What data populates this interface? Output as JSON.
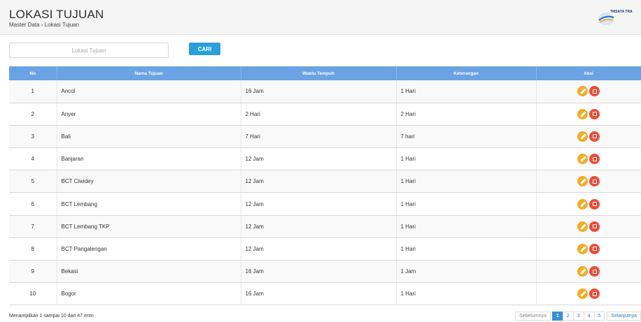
{
  "header": {
    "title": "LOKASI TUJUAN",
    "breadcrumb": "Master Data › Lokasi Tujuan",
    "logo_text": "TMSAYA TRA"
  },
  "search": {
    "placeholder": "Lokasi Tujuan",
    "button_label": "CARI",
    "button_color": "#2a9fd8"
  },
  "table": {
    "header_color": "#6aa2e3",
    "columns": [
      "No",
      "Nama Tujuan",
      "Waktu Tempuh",
      "Keterangan",
      "Aksi"
    ],
    "rows": [
      {
        "no": "1",
        "nama": "Ancol",
        "waktu": "16 Jam",
        "keterangan": "1 Hari"
      },
      {
        "no": "2",
        "nama": "Anyer",
        "waktu": "2 Hari",
        "keterangan": "2 Hari"
      },
      {
        "no": "3",
        "nama": "Bali",
        "waktu": "7 Hari",
        "keterangan": "7 hari"
      },
      {
        "no": "4",
        "nama": "Banjaran",
        "waktu": "12 Jam",
        "keterangan": "1 Hari"
      },
      {
        "no": "5",
        "nama": "BCT Ciwidey",
        "waktu": "12 Jam",
        "keterangan": "1 Hari"
      },
      {
        "no": "6",
        "nama": "BCT Lembang",
        "waktu": "12 Jam",
        "keterangan": "1 Hari"
      },
      {
        "no": "7",
        "nama": "BCT Lembang TKP",
        "waktu": "12 Jam",
        "keterangan": "1 Hari"
      },
      {
        "no": "8",
        "nama": "BCT Pangalengan",
        "waktu": "12 Jam",
        "keterangan": "1 Hari"
      },
      {
        "no": "9",
        "nama": "Bekasi",
        "waktu": "16 Jam",
        "keterangan": "1 Jam"
      },
      {
        "no": "10",
        "nama": "Bogor",
        "waktu": "16 Jam",
        "keterangan": "1 Hari"
      }
    ],
    "actions": {
      "edit_icon": "pencil-icon",
      "delete_icon": "trash-icon",
      "edit_color": "#f0ad28",
      "delete_color": "#ec4d3a"
    }
  },
  "footer": {
    "info": "Menampilkan 1 sampai 10 dari 47 entri",
    "pagination": {
      "prev": "Sebelumnya",
      "pages": [
        "1",
        "2",
        "3",
        "4",
        "5"
      ],
      "active_page": "1",
      "next": "Selanjutnya"
    }
  }
}
